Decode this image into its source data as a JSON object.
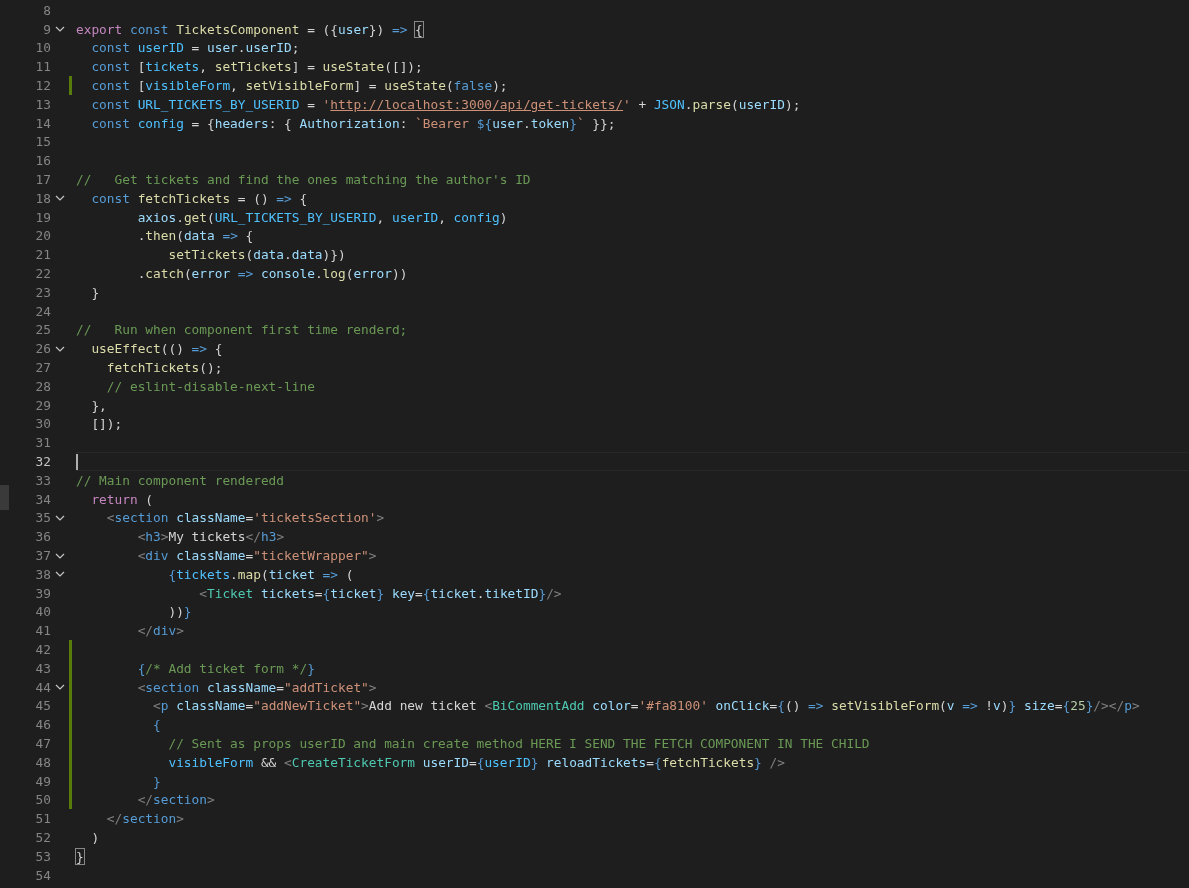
{
  "editor": {
    "lines": [
      {
        "number": "8",
        "foldable": false,
        "modified": false,
        "current": false
      },
      {
        "number": "9",
        "foldable": true,
        "modified": false,
        "current": false,
        "tokens": [
          {
            "kind": "x",
            "text": "export "
          },
          {
            "kind": "k",
            "text": "const "
          },
          {
            "kind": "f",
            "text": "TicketsComponent"
          },
          {
            "kind": "t",
            "text": " = ({"
          },
          {
            "kind": "v",
            "text": "user"
          },
          {
            "kind": "t",
            "text": "}) "
          },
          {
            "kind": "k",
            "text": "=> "
          },
          {
            "kind": "bm",
            "text": "{"
          }
        ]
      },
      {
        "number": "10",
        "foldable": false,
        "modified": false,
        "current": false,
        "tokens": [
          {
            "kind": "k",
            "text": "  const "
          },
          {
            "kind": "C",
            "text": "userID"
          },
          {
            "kind": "t",
            "text": " = "
          },
          {
            "kind": "v",
            "text": "user"
          },
          {
            "kind": "t",
            "text": "."
          },
          {
            "kind": "v",
            "text": "userID"
          },
          {
            "kind": "t",
            "text": ";"
          }
        ]
      },
      {
        "number": "11",
        "foldable": false,
        "modified": false,
        "current": false,
        "tokens": [
          {
            "kind": "k",
            "text": "  const"
          },
          {
            "kind": "t",
            "text": " ["
          },
          {
            "kind": "C",
            "text": "tickets"
          },
          {
            "kind": "t",
            "text": ", "
          },
          {
            "kind": "f",
            "text": "setTickets"
          },
          {
            "kind": "t",
            "text": "] = "
          },
          {
            "kind": "f",
            "text": "useState"
          },
          {
            "kind": "t",
            "text": "([]);"
          }
        ]
      },
      {
        "number": "12",
        "foldable": false,
        "modified": true,
        "current": false,
        "tokens": [
          {
            "kind": "k",
            "text": "  const"
          },
          {
            "kind": "t",
            "text": " ["
          },
          {
            "kind": "C",
            "text": "visibleForm"
          },
          {
            "kind": "t",
            "text": ", "
          },
          {
            "kind": "f",
            "text": "setVisibleForm"
          },
          {
            "kind": "t",
            "text": "] = "
          },
          {
            "kind": "f",
            "text": "useState"
          },
          {
            "kind": "t",
            "text": "("
          },
          {
            "kind": "k",
            "text": "false"
          },
          {
            "kind": "t",
            "text": ");"
          }
        ]
      },
      {
        "number": "13",
        "foldable": false,
        "modified": false,
        "current": false,
        "tokens": [
          {
            "kind": "k",
            "text": "  const "
          },
          {
            "kind": "C",
            "text": "URL_TICKETS_BY_USERID"
          },
          {
            "kind": "t",
            "text": " = "
          },
          {
            "kind": "s",
            "text": "'"
          },
          {
            "kind": "u",
            "text": "http://localhost:3000/api/get-tickets/"
          },
          {
            "kind": "s",
            "text": "'"
          },
          {
            "kind": "t",
            "text": " + "
          },
          {
            "kind": "C",
            "text": "JSON"
          },
          {
            "kind": "t",
            "text": "."
          },
          {
            "kind": "f",
            "text": "parse"
          },
          {
            "kind": "t",
            "text": "("
          },
          {
            "kind": "v",
            "text": "userID"
          },
          {
            "kind": "t",
            "text": ");"
          }
        ]
      },
      {
        "number": "14",
        "foldable": false,
        "modified": false,
        "current": false,
        "tokens": [
          {
            "kind": "k",
            "text": "  const "
          },
          {
            "kind": "C",
            "text": "config"
          },
          {
            "kind": "t",
            "text": " = {"
          },
          {
            "kind": "v",
            "text": "headers"
          },
          {
            "kind": "t",
            "text": ": { "
          },
          {
            "kind": "v",
            "text": "Authorization"
          },
          {
            "kind": "t",
            "text": ": "
          },
          {
            "kind": "s",
            "text": "`Bearer "
          },
          {
            "kind": "k",
            "text": "${"
          },
          {
            "kind": "v",
            "text": "user"
          },
          {
            "kind": "t",
            "text": "."
          },
          {
            "kind": "v",
            "text": "token"
          },
          {
            "kind": "k",
            "text": "}"
          },
          {
            "kind": "s",
            "text": "`"
          },
          {
            "kind": "t",
            "text": " }};"
          }
        ]
      },
      {
        "number": "15",
        "foldable": false,
        "modified": false,
        "current": false
      },
      {
        "number": "16",
        "foldable": false,
        "modified": false,
        "current": false
      },
      {
        "number": "17",
        "foldable": false,
        "modified": false,
        "current": false,
        "tokens": [
          {
            "kind": "m",
            "text": "//   Get tickets and find the ones matching the author's ID"
          }
        ]
      },
      {
        "number": "18",
        "foldable": true,
        "modified": false,
        "current": false,
        "tokens": [
          {
            "kind": "k",
            "text": "  const "
          },
          {
            "kind": "f",
            "text": "fetchTickets"
          },
          {
            "kind": "t",
            "text": " = () "
          },
          {
            "kind": "k",
            "text": "=>"
          },
          {
            "kind": "t",
            "text": " {"
          }
        ]
      },
      {
        "number": "19",
        "foldable": false,
        "modified": false,
        "current": false,
        "tokens": [
          {
            "kind": "v",
            "text": "        axios"
          },
          {
            "kind": "t",
            "text": "."
          },
          {
            "kind": "f",
            "text": "get"
          },
          {
            "kind": "t",
            "text": "("
          },
          {
            "kind": "C",
            "text": "URL_TICKETS_BY_USERID"
          },
          {
            "kind": "t",
            "text": ", "
          },
          {
            "kind": "C",
            "text": "userID"
          },
          {
            "kind": "t",
            "text": ", "
          },
          {
            "kind": "C",
            "text": "config"
          },
          {
            "kind": "t",
            "text": ")"
          }
        ]
      },
      {
        "number": "20",
        "foldable": false,
        "modified": false,
        "current": false,
        "tokens": [
          {
            "kind": "t",
            "text": "        ."
          },
          {
            "kind": "f",
            "text": "then"
          },
          {
            "kind": "t",
            "text": "("
          },
          {
            "kind": "v",
            "text": "data "
          },
          {
            "kind": "k",
            "text": "=>"
          },
          {
            "kind": "t",
            "text": " {"
          }
        ]
      },
      {
        "number": "21",
        "foldable": false,
        "modified": false,
        "current": false,
        "tokens": [
          {
            "kind": "f",
            "text": "            setTickets"
          },
          {
            "kind": "t",
            "text": "("
          },
          {
            "kind": "v",
            "text": "data"
          },
          {
            "kind": "t",
            "text": "."
          },
          {
            "kind": "v",
            "text": "data"
          },
          {
            "kind": "t",
            "text": ")})"
          }
        ]
      },
      {
        "number": "22",
        "foldable": false,
        "modified": false,
        "current": false,
        "tokens": [
          {
            "kind": "t",
            "text": "        ."
          },
          {
            "kind": "f",
            "text": "catch"
          },
          {
            "kind": "t",
            "text": "("
          },
          {
            "kind": "v",
            "text": "error "
          },
          {
            "kind": "k",
            "text": "=> "
          },
          {
            "kind": "v",
            "text": "console"
          },
          {
            "kind": "t",
            "text": "."
          },
          {
            "kind": "f",
            "text": "log"
          },
          {
            "kind": "t",
            "text": "("
          },
          {
            "kind": "v",
            "text": "error"
          },
          {
            "kind": "t",
            "text": "))"
          }
        ]
      },
      {
        "number": "23",
        "foldable": false,
        "modified": false,
        "current": false,
        "tokens": [
          {
            "kind": "t",
            "text": "  }"
          }
        ]
      },
      {
        "number": "24",
        "foldable": false,
        "modified": false,
        "current": false
      },
      {
        "number": "25",
        "foldable": false,
        "modified": false,
        "current": false,
        "tokens": [
          {
            "kind": "m",
            "text": "//   Run when component first time renderd;"
          }
        ]
      },
      {
        "number": "26",
        "foldable": true,
        "modified": false,
        "current": false,
        "tokens": [
          {
            "kind": "f",
            "text": "  useEffect"
          },
          {
            "kind": "t",
            "text": "(() "
          },
          {
            "kind": "k",
            "text": "=>"
          },
          {
            "kind": "t",
            "text": " {"
          }
        ]
      },
      {
        "number": "27",
        "foldable": false,
        "modified": false,
        "current": false,
        "tokens": [
          {
            "kind": "f",
            "text": "    fetchTickets"
          },
          {
            "kind": "t",
            "text": "();"
          }
        ]
      },
      {
        "number": "28",
        "foldable": false,
        "modified": false,
        "current": false,
        "tokens": [
          {
            "kind": "m",
            "text": "    // eslint-disable-next-line"
          }
        ]
      },
      {
        "number": "29",
        "foldable": false,
        "modified": false,
        "current": false,
        "tokens": [
          {
            "kind": "t",
            "text": "  },"
          }
        ]
      },
      {
        "number": "30",
        "foldable": false,
        "modified": false,
        "current": false,
        "tokens": [
          {
            "kind": "t",
            "text": "  []);"
          }
        ]
      },
      {
        "number": "31",
        "foldable": false,
        "modified": false,
        "current": false
      },
      {
        "number": "32",
        "foldable": false,
        "modified": false,
        "current": true
      },
      {
        "number": "33",
        "foldable": false,
        "modified": false,
        "current": false,
        "tokens": [
          {
            "kind": "m",
            "text": "// Main component renderedd"
          }
        ]
      },
      {
        "number": "34",
        "foldable": false,
        "modified": false,
        "current": false,
        "tokens": [
          {
            "kind": "x",
            "text": "  return"
          },
          {
            "kind": "t",
            "text": " ("
          }
        ]
      },
      {
        "number": "35",
        "foldable": true,
        "modified": false,
        "current": false,
        "tokens": [
          {
            "kind": "g",
            "text": "    <"
          },
          {
            "kind": "k",
            "text": "section "
          },
          {
            "kind": "v",
            "text": "className"
          },
          {
            "kind": "t",
            "text": "="
          },
          {
            "kind": "s",
            "text": "'ticketsSection'"
          },
          {
            "kind": "g",
            "text": ">"
          }
        ]
      },
      {
        "number": "36",
        "foldable": false,
        "modified": false,
        "current": false,
        "tokens": [
          {
            "kind": "g",
            "text": "        <"
          },
          {
            "kind": "k",
            "text": "h3"
          },
          {
            "kind": "g",
            "text": ">"
          },
          {
            "kind": "t",
            "text": "My tickets"
          },
          {
            "kind": "g",
            "text": "</"
          },
          {
            "kind": "k",
            "text": "h3"
          },
          {
            "kind": "g",
            "text": ">"
          }
        ]
      },
      {
        "number": "37",
        "foldable": true,
        "modified": false,
        "current": false,
        "tokens": [
          {
            "kind": "g",
            "text": "        <"
          },
          {
            "kind": "k",
            "text": "div "
          },
          {
            "kind": "v",
            "text": "className"
          },
          {
            "kind": "t",
            "text": "="
          },
          {
            "kind": "s",
            "text": "\"ticketWrapper\""
          },
          {
            "kind": "g",
            "text": ">"
          }
        ]
      },
      {
        "number": "38",
        "foldable": true,
        "modified": false,
        "current": false,
        "tokens": [
          {
            "kind": "k",
            "text": "            {"
          },
          {
            "kind": "C",
            "text": "tickets"
          },
          {
            "kind": "t",
            "text": "."
          },
          {
            "kind": "f",
            "text": "map"
          },
          {
            "kind": "t",
            "text": "("
          },
          {
            "kind": "v",
            "text": "ticket "
          },
          {
            "kind": "k",
            "text": "=>"
          },
          {
            "kind": "t",
            "text": " ("
          }
        ]
      },
      {
        "number": "39",
        "foldable": false,
        "modified": false,
        "current": false,
        "tokens": [
          {
            "kind": "g",
            "text": "                <"
          },
          {
            "kind": "n",
            "text": "Ticket "
          },
          {
            "kind": "v",
            "text": "tickets"
          },
          {
            "kind": "t",
            "text": "="
          },
          {
            "kind": "k",
            "text": "{"
          },
          {
            "kind": "v",
            "text": "ticket"
          },
          {
            "kind": "k",
            "text": "} "
          },
          {
            "kind": "v",
            "text": "key"
          },
          {
            "kind": "t",
            "text": "="
          },
          {
            "kind": "k",
            "text": "{"
          },
          {
            "kind": "v",
            "text": "ticket"
          },
          {
            "kind": "t",
            "text": "."
          },
          {
            "kind": "v",
            "text": "tiketID"
          },
          {
            "kind": "k",
            "text": "}"
          },
          {
            "kind": "g",
            "text": "/>"
          }
        ]
      },
      {
        "number": "40",
        "foldable": false,
        "modified": false,
        "current": false,
        "tokens": [
          {
            "kind": "t",
            "text": "            ))"
          },
          {
            "kind": "k",
            "text": "}"
          }
        ]
      },
      {
        "number": "41",
        "foldable": false,
        "modified": false,
        "current": false,
        "tokens": [
          {
            "kind": "g",
            "text": "        </"
          },
          {
            "kind": "k",
            "text": "div"
          },
          {
            "kind": "g",
            "text": ">"
          }
        ]
      },
      {
        "number": "42",
        "foldable": false,
        "modified": true,
        "current": false
      },
      {
        "number": "43",
        "foldable": false,
        "modified": true,
        "current": false,
        "tokens": [
          {
            "kind": "k",
            "text": "        {"
          },
          {
            "kind": "m",
            "text": "/* Add ticket form */"
          },
          {
            "kind": "k",
            "text": "}"
          }
        ]
      },
      {
        "number": "44",
        "foldable": true,
        "modified": true,
        "current": false,
        "tokens": [
          {
            "kind": "g",
            "text": "        <"
          },
          {
            "kind": "k",
            "text": "section "
          },
          {
            "kind": "v",
            "text": "className"
          },
          {
            "kind": "t",
            "text": "="
          },
          {
            "kind": "s",
            "text": "\"addTicket\""
          },
          {
            "kind": "g",
            "text": ">"
          }
        ]
      },
      {
        "number": "45",
        "foldable": false,
        "modified": true,
        "current": false,
        "tokens": [
          {
            "kind": "g",
            "text": "          <"
          },
          {
            "kind": "k",
            "text": "p "
          },
          {
            "kind": "v",
            "text": "className"
          },
          {
            "kind": "t",
            "text": "="
          },
          {
            "kind": "s",
            "text": "\"addNewTicket\""
          },
          {
            "kind": "g",
            "text": ">"
          },
          {
            "kind": "t",
            "text": "Add new ticket "
          },
          {
            "kind": "g",
            "text": "<"
          },
          {
            "kind": "n",
            "text": "BiCommentAdd "
          },
          {
            "kind": "v",
            "text": "color"
          },
          {
            "kind": "t",
            "text": "="
          },
          {
            "kind": "s",
            "text": "'#fa8100' "
          },
          {
            "kind": "v",
            "text": "onClick"
          },
          {
            "kind": "t",
            "text": "="
          },
          {
            "kind": "k",
            "text": "{"
          },
          {
            "kind": "t",
            "text": "() "
          },
          {
            "kind": "k",
            "text": "=> "
          },
          {
            "kind": "f",
            "text": "setVisibleForm"
          },
          {
            "kind": "t",
            "text": "("
          },
          {
            "kind": "v",
            "text": "v "
          },
          {
            "kind": "k",
            "text": "=>"
          },
          {
            "kind": "t",
            "text": " !"
          },
          {
            "kind": "v",
            "text": "v"
          },
          {
            "kind": "t",
            "text": ")"
          },
          {
            "kind": "k",
            "text": "} "
          },
          {
            "kind": "v",
            "text": "size"
          },
          {
            "kind": "t",
            "text": "="
          },
          {
            "kind": "k",
            "text": "{"
          },
          {
            "kind": "N",
            "text": "25"
          },
          {
            "kind": "k",
            "text": "}"
          },
          {
            "kind": "g",
            "text": "/></"
          },
          {
            "kind": "k",
            "text": "p"
          },
          {
            "kind": "g",
            "text": ">"
          }
        ]
      },
      {
        "number": "46",
        "foldable": false,
        "modified": true,
        "current": false,
        "tokens": [
          {
            "kind": "k",
            "text": "          {"
          }
        ]
      },
      {
        "number": "47",
        "foldable": false,
        "modified": true,
        "current": false,
        "tokens": [
          {
            "kind": "m",
            "text": "            // Sent as props userID and main create method HERE I SEND THE FETCH COMPONENT IN THE CHILD"
          }
        ]
      },
      {
        "number": "48",
        "foldable": false,
        "modified": true,
        "current": false,
        "tokens": [
          {
            "kind": "C",
            "text": "            visibleForm"
          },
          {
            "kind": "t",
            "text": " && "
          },
          {
            "kind": "g",
            "text": "<"
          },
          {
            "kind": "n",
            "text": "CreateTicketForm "
          },
          {
            "kind": "v",
            "text": "userID"
          },
          {
            "kind": "t",
            "text": "="
          },
          {
            "kind": "k",
            "text": "{"
          },
          {
            "kind": "C",
            "text": "userID"
          },
          {
            "kind": "k",
            "text": "} "
          },
          {
            "kind": "v",
            "text": "reloadTickets"
          },
          {
            "kind": "t",
            "text": "="
          },
          {
            "kind": "k",
            "text": "{"
          },
          {
            "kind": "f",
            "text": "fetchTickets"
          },
          {
            "kind": "k",
            "text": "} "
          },
          {
            "kind": "g",
            "text": "/>"
          }
        ]
      },
      {
        "number": "49",
        "foldable": false,
        "modified": true,
        "current": false,
        "tokens": [
          {
            "kind": "k",
            "text": "          }"
          }
        ]
      },
      {
        "number": "50",
        "foldable": false,
        "modified": true,
        "current": false,
        "tokens": [
          {
            "kind": "g",
            "text": "        </"
          },
          {
            "kind": "k",
            "text": "section"
          },
          {
            "kind": "g",
            "text": ">"
          }
        ]
      },
      {
        "number": "51",
        "foldable": false,
        "modified": false,
        "current": false,
        "tokens": [
          {
            "kind": "g",
            "text": "    </"
          },
          {
            "kind": "k",
            "text": "section"
          },
          {
            "kind": "g",
            "text": ">"
          }
        ]
      },
      {
        "number": "52",
        "foldable": false,
        "modified": false,
        "current": false,
        "tokens": [
          {
            "kind": "t",
            "text": "  )"
          }
        ]
      },
      {
        "number": "53",
        "foldable": false,
        "modified": false,
        "current": false,
        "tokens": [
          {
            "kind": "bm",
            "text": "}"
          }
        ]
      },
      {
        "number": "54",
        "foldable": false,
        "modified": false,
        "current": false
      }
    ]
  }
}
